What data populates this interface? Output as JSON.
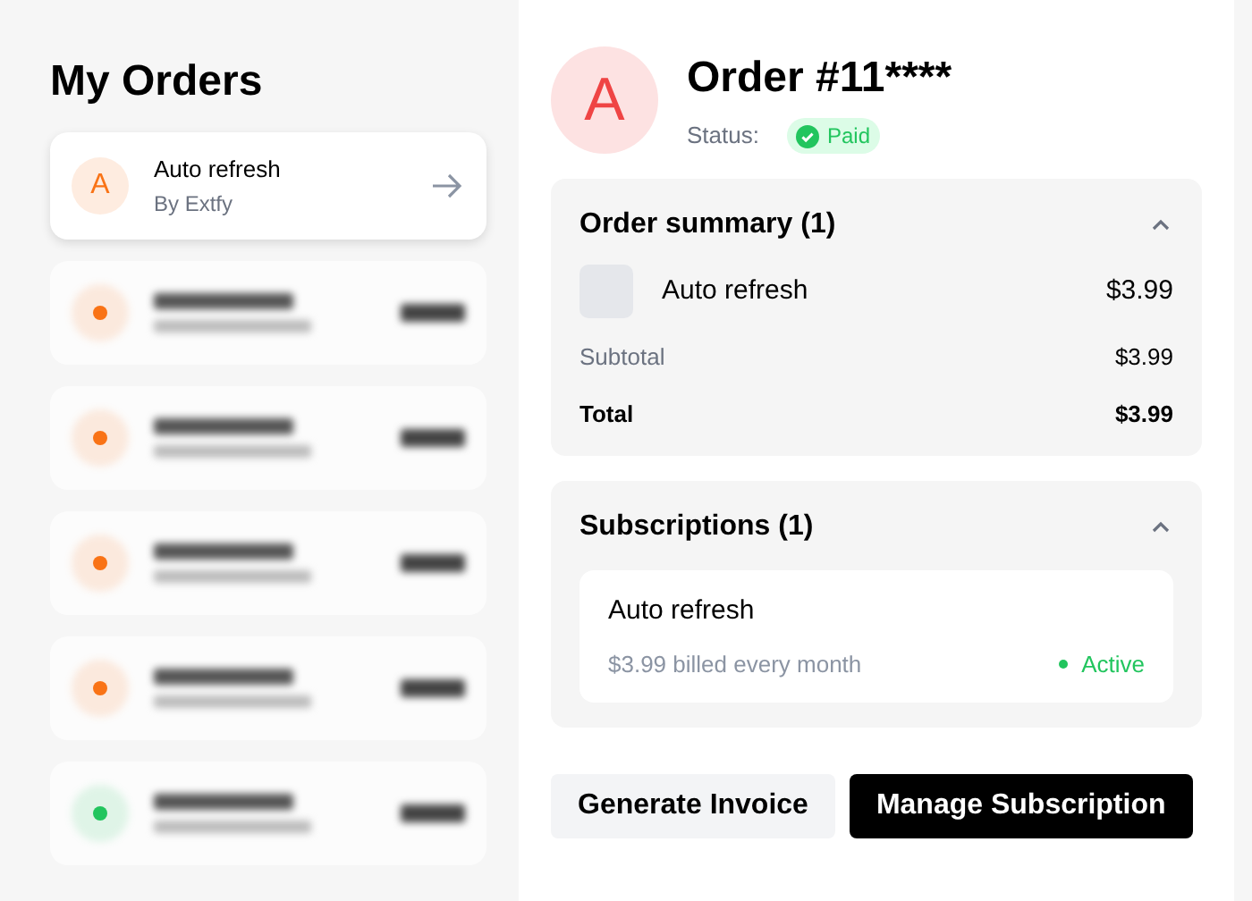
{
  "sidebar": {
    "title": "My Orders",
    "orders": [
      {
        "kind": "card",
        "initial": "A",
        "name": "Auto refresh",
        "vendor": "By Extfy",
        "selected": true,
        "color": "#f97316"
      },
      {
        "kind": "blurred",
        "color": "#f97316"
      },
      {
        "kind": "blurred",
        "color": "#f97316"
      },
      {
        "kind": "blurred",
        "color": "#f97316"
      },
      {
        "kind": "blurred",
        "color": "#f97316"
      },
      {
        "kind": "blurred",
        "color": "#22c55e"
      }
    ]
  },
  "order": {
    "initial": "A",
    "title": "Order #11****",
    "status_label": "Status:",
    "status": "Paid",
    "summary": {
      "title": "Order summary (1)",
      "expanded": true,
      "items": [
        {
          "name": "Auto refresh",
          "price": "$3.99"
        }
      ],
      "subtotal_label": "Subtotal",
      "subtotal": "$3.99",
      "total_label": "Total",
      "total": "$3.99"
    },
    "subscriptions": {
      "title": "Subscriptions (1)",
      "expanded": true,
      "items": [
        {
          "name": "Auto refresh",
          "billing": "$3.99 billed every month",
          "status": "Active",
          "color": "#22c55e"
        }
      ]
    },
    "buttons": [
      {
        "label": "Generate Invoice",
        "kind": "secondary"
      },
      {
        "label": "Manage Subscription",
        "kind": "primary"
      }
    ]
  }
}
